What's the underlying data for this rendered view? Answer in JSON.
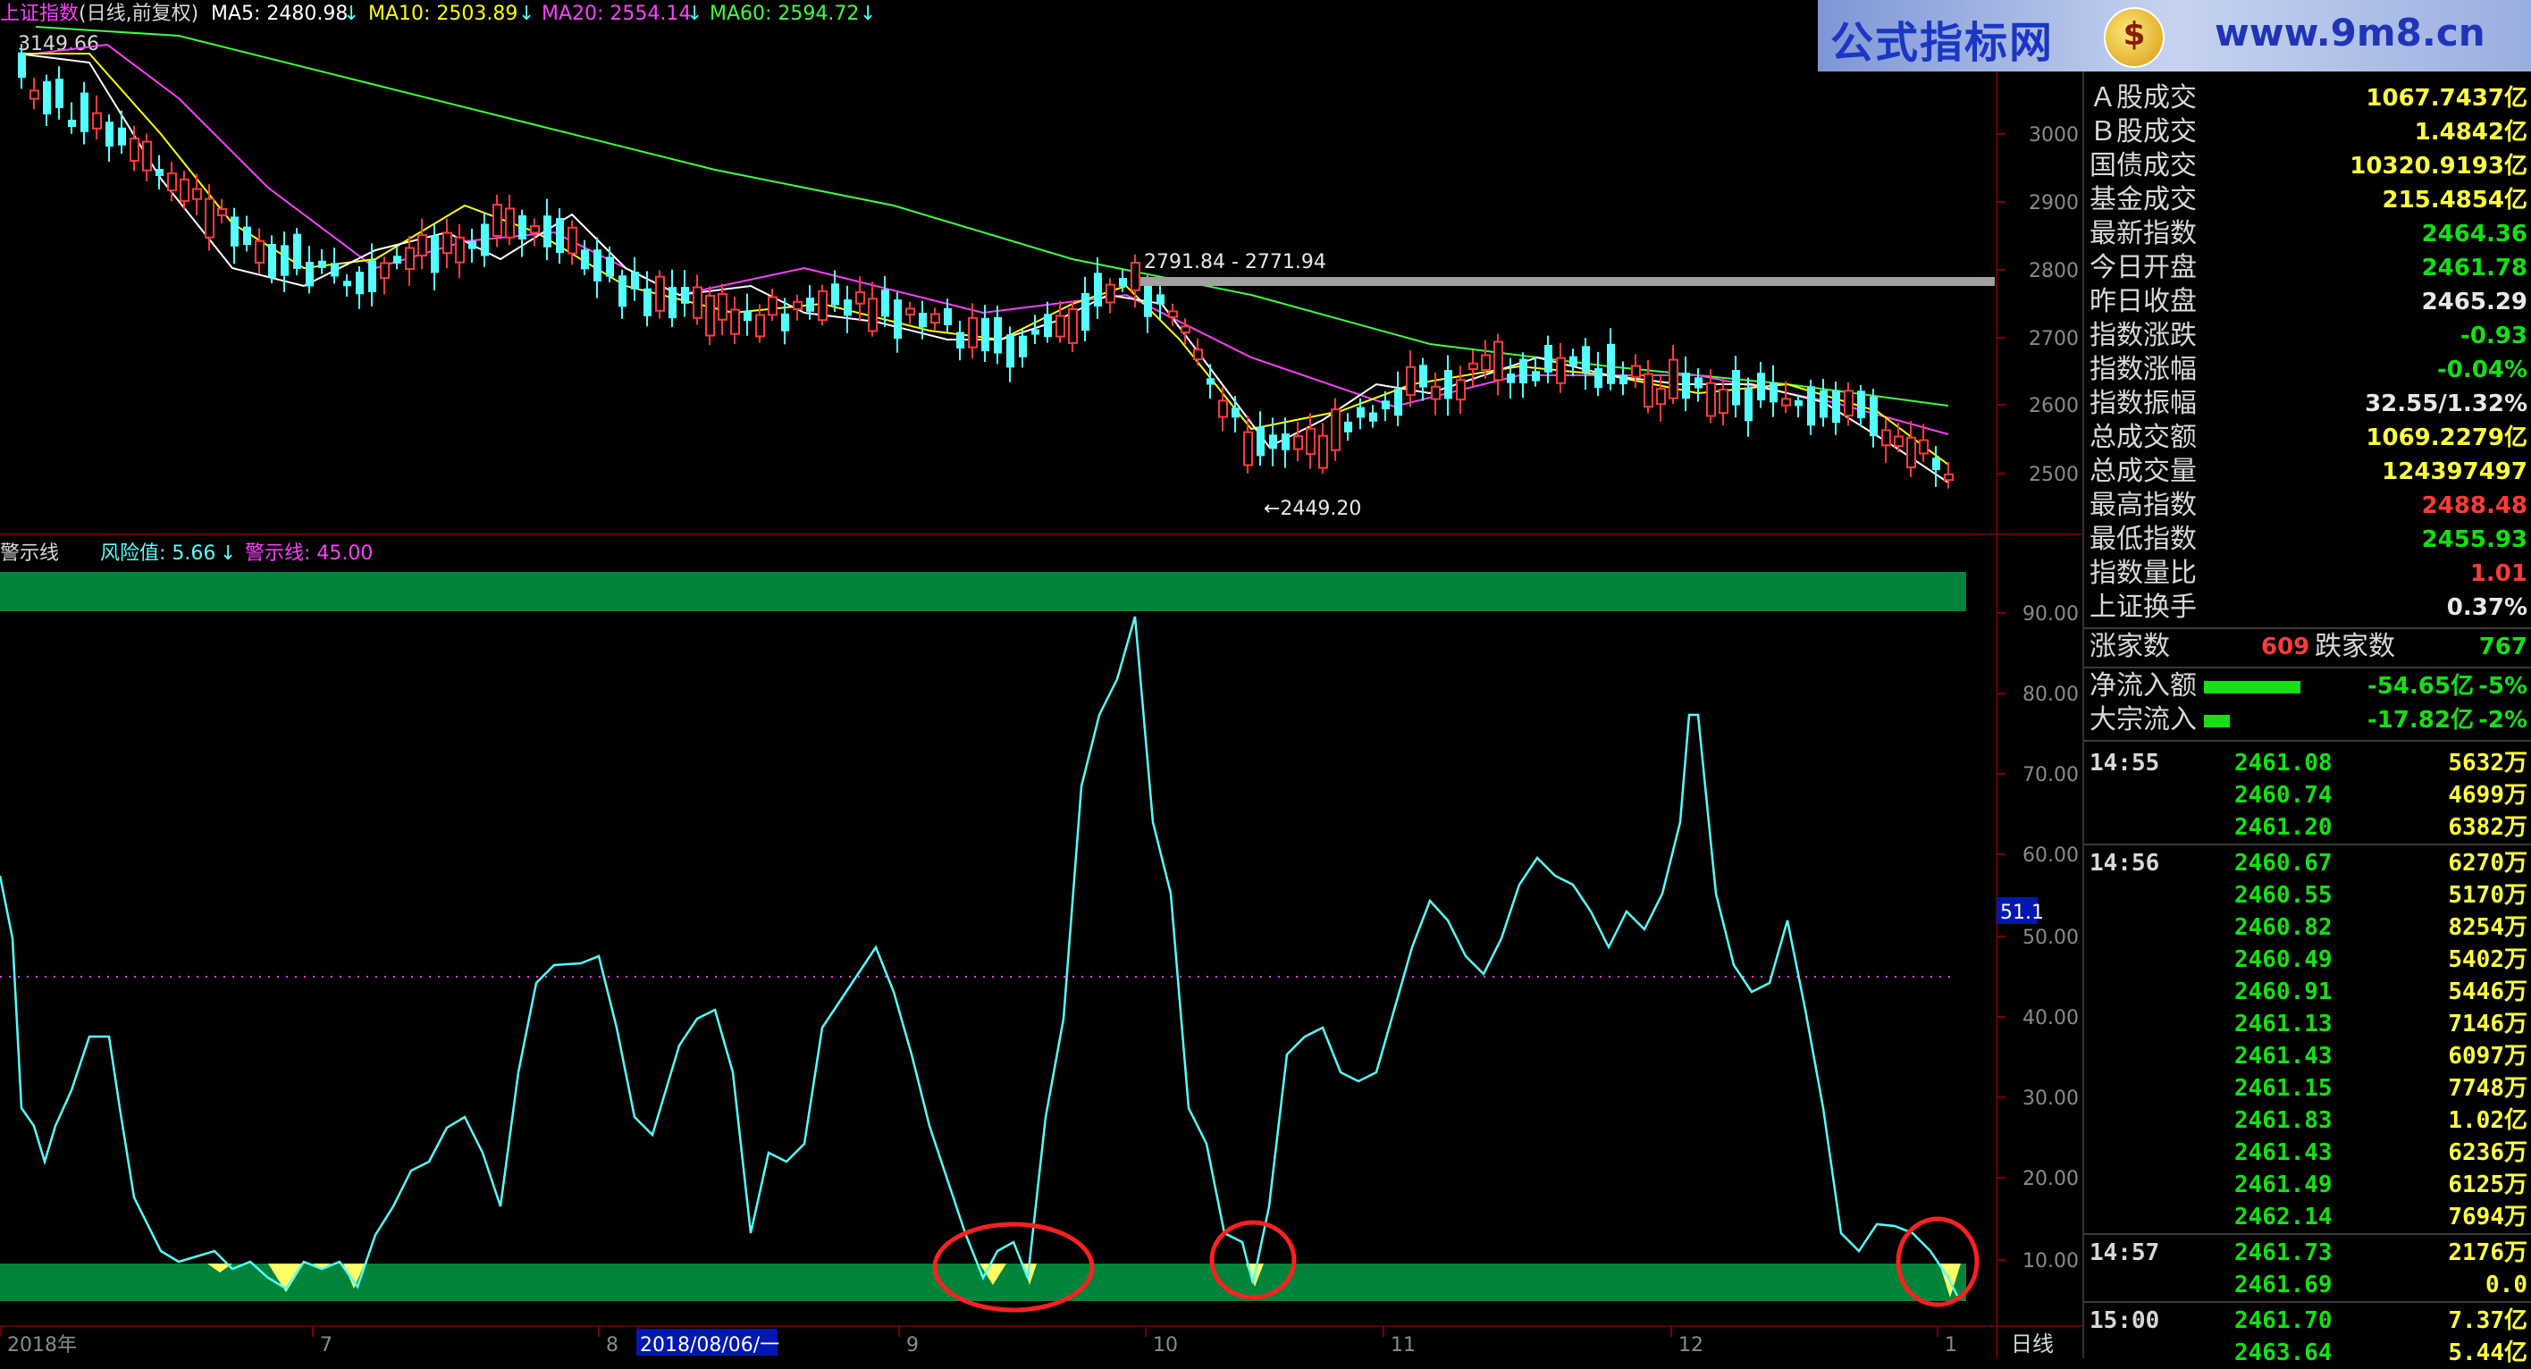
{
  "header": {
    "index_name": "上证指数",
    "mode": "(日线,前复权)",
    "ma5": "MA5: 2480.98",
    "ma10": "MA10: 2503.89",
    "ma20": "MA20: 2554.14",
    "ma60": "MA60: 2594.72",
    "arrow": "↓",
    "left_top_label": "3149.66"
  },
  "brand": {
    "name": "公式指标网",
    "url": "www.9m8.cn",
    "logo_char": "$"
  },
  "price_axis": {
    "ticks": [
      "3000",
      "2900",
      "2800",
      "2700",
      "2600",
      "2500"
    ]
  },
  "annotations": {
    "high_range": "2791.84 - 2771.94",
    "low_mark": "←2449.20"
  },
  "indicator": {
    "name": "警示线",
    "risk_label": "风险值: 5.66",
    "warn_label": "警示线: 45.00",
    "current_badge": "51.1",
    "axis_ticks": [
      "90.00",
      "80.00",
      "70.00",
      "60.00",
      "50.00",
      "40.00",
      "30.00",
      "20.00",
      "10.00"
    ]
  },
  "time_axis": {
    "labels": [
      "2018年",
      "7",
      "8",
      "2018/08/06/一",
      "9",
      "10",
      "11",
      "12",
      "1"
    ],
    "period": "日线"
  },
  "colors": {
    "up": "#ff3a3a",
    "down": "#54ffff",
    "ma5": "#ffffff",
    "ma10": "#ffff00",
    "ma20": "#ff40ff",
    "ma60": "#40ff40",
    "band": "#00843c",
    "risk_line": "#54ffff",
    "highlight": "#ffff66",
    "circle": "#ff2020"
  },
  "stats": [
    {
      "label": "Ａ股成交",
      "value": "1067.7437亿",
      "color": "#ffff40"
    },
    {
      "label": "Ｂ股成交",
      "value": "1.4842亿",
      "color": "#ffff40"
    },
    {
      "label": "国债成交",
      "value": "10320.9193亿",
      "color": "#ffff40"
    },
    {
      "label": "基金成交",
      "value": "215.4854亿",
      "color": "#ffff40"
    },
    {
      "label": "最新指数",
      "value": "2464.36",
      "color": "#14e014"
    },
    {
      "label": "今日开盘",
      "value": "2461.78",
      "color": "#14e014"
    },
    {
      "label": "昨日收盘",
      "value": "2465.29",
      "color": "#e8e8e8"
    },
    {
      "label": "指数涨跌",
      "value": "-0.93",
      "color": "#14e014"
    },
    {
      "label": "指数涨幅",
      "value": "-0.04%",
      "color": "#14e014"
    },
    {
      "label": "指数振幅",
      "value": "32.55/1.32%",
      "color": "#e8e8e8"
    },
    {
      "label": "总成交额",
      "value": "1069.2279亿",
      "color": "#ffff40"
    },
    {
      "label": "总成交量",
      "value": "124397497",
      "color": "#ffff40"
    },
    {
      "label": "最高指数",
      "value": "2488.48",
      "color": "#ff3a3a"
    },
    {
      "label": "最低指数",
      "value": "2455.93",
      "color": "#14e014"
    },
    {
      "label": "指数量比",
      "value": "1.01",
      "color": "#ff3a3a"
    },
    {
      "label": "上证换手",
      "value": "0.37%",
      "color": "#e8e8e8"
    }
  ],
  "breadth": {
    "up_label": "涨家数",
    "up_value": "609",
    "down_label": "跌家数",
    "down_value": "767"
  },
  "flows": [
    {
      "label": "净流入额",
      "value": "-54.65亿",
      "pct": "-5%",
      "fill": 0.6
    },
    {
      "label": "大宗流入",
      "value": "-17.82亿",
      "pct": "-2%",
      "fill": 0.16
    }
  ],
  "ticks": [
    {
      "time": "14:55",
      "price": "2461.08",
      "vol": "5632万"
    },
    {
      "time": "",
      "price": "2460.74",
      "vol": "4699万"
    },
    {
      "time": "",
      "price": "2461.20",
      "vol": "6382万"
    },
    {
      "time": "14:56",
      "price": "2460.67",
      "vol": "6270万"
    },
    {
      "time": "",
      "price": "2460.55",
      "vol": "5170万"
    },
    {
      "time": "",
      "price": "2460.82",
      "vol": "8254万"
    },
    {
      "time": "",
      "price": "2460.49",
      "vol": "5402万"
    },
    {
      "time": "",
      "price": "2460.91",
      "vol": "5446万"
    },
    {
      "time": "",
      "price": "2461.13",
      "vol": "7146万"
    },
    {
      "time": "",
      "price": "2461.43",
      "vol": "6097万"
    },
    {
      "time": "",
      "price": "2461.15",
      "vol": "7748万"
    },
    {
      "time": "",
      "price": "2461.83",
      "vol": "1.02亿"
    },
    {
      "time": "",
      "price": "2461.43",
      "vol": "6236万"
    },
    {
      "time": "",
      "price": "2461.49",
      "vol": "6125万"
    },
    {
      "time": "",
      "price": "2462.14",
      "vol": "7694万"
    },
    {
      "time": "14:57",
      "price": "2461.73",
      "vol": "2176万"
    },
    {
      "time": "",
      "price": "2461.69",
      "vol": "0.0"
    },
    {
      "time": "15:00",
      "price": "2461.70",
      "vol": "7.37亿"
    },
    {
      "time": "",
      "price": "2463.64",
      "vol": "5.44亿"
    }
  ]
}
